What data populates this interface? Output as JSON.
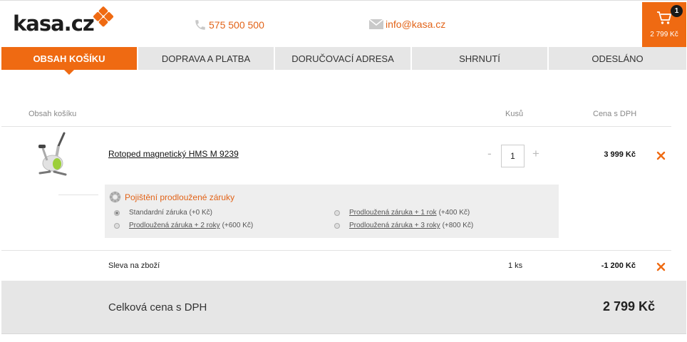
{
  "header": {
    "logo_text": "kasa.cz",
    "phone": "575 500 500",
    "email": "info@kasa.cz",
    "cart": {
      "count": "1",
      "total": "2 799 Kč"
    },
    "accent_color": "#ef6a12"
  },
  "steps": [
    {
      "label": "OBSAH KOŠÍKU",
      "active": true
    },
    {
      "label": "DOPRAVA A PLATBA",
      "active": false
    },
    {
      "label": "DORUČOVACÍ ADRESA",
      "active": false
    },
    {
      "label": "SHRNUTÍ",
      "active": false
    },
    {
      "label": "ODESLÁNO",
      "active": false
    }
  ],
  "table": {
    "col_content": "Obsah košíku",
    "col_qty": "Kusů",
    "col_price": "Cena s DPH"
  },
  "item": {
    "name": "Rotoped magnetický HMS M 9239",
    "qty_minus": "-",
    "qty_plus": "+",
    "qty": "1",
    "price": "3 999 Kč",
    "image": "exercise-bike-image"
  },
  "warranty": {
    "title": "Pojištění prodloužené záruky",
    "options": [
      {
        "label": "Standardní záruka",
        "extra": "(+0 Kč)",
        "link": false,
        "selected": true
      },
      {
        "label": "Prodloužená záruka + 1 rok",
        "extra": "(+400 Kč)",
        "link": true,
        "selected": false
      },
      {
        "label": "Prodloužená záruka + 2 roky",
        "extra": "(+600 Kč)",
        "link": true,
        "selected": false
      },
      {
        "label": "Prodloužená záruka + 3 roky",
        "extra": "(+800 Kč)",
        "link": true,
        "selected": false
      }
    ]
  },
  "discount": {
    "label": "Sleva na zboží",
    "qty": "1 ks",
    "price": "-1 200 Kč"
  },
  "total": {
    "label": "Celková cena s DPH",
    "value": "2 799 Kč"
  }
}
